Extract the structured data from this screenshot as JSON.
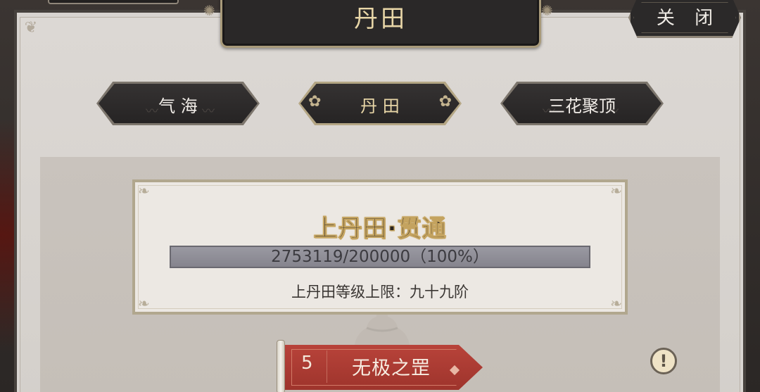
{
  "window": {
    "title": "丹田",
    "close_label": "关 闭"
  },
  "tabs": [
    {
      "label": "气 海",
      "active": false
    },
    {
      "label": "丹 田",
      "active": true
    },
    {
      "label": "三花聚顶",
      "active": false
    }
  ],
  "realm": {
    "title": "上丹田·贯通",
    "progress_text": "2753119/200000（100%）",
    "progress_current": 2753119,
    "progress_max": 200000,
    "progress_fraction": 1.0,
    "limit_text": "上丹田等级上限：九十九阶"
  },
  "technique": {
    "number": "5",
    "name": "无极之罡"
  },
  "info_icon_glyph": "!",
  "colors": {
    "accent_gold": "#e8d6a7",
    "tab_dark": "#2b2929",
    "scroll_red": "#b8433a",
    "progress_fill": "#8e8d96"
  }
}
